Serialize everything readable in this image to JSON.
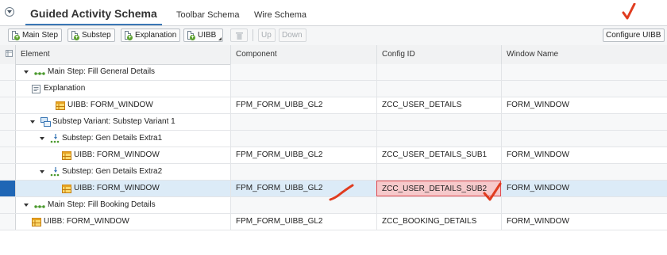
{
  "tabs": [
    {
      "label": "Guided Activity Schema",
      "active": true
    },
    {
      "label": "Toolbar Schema",
      "active": false
    },
    {
      "label": "Wire Schema",
      "active": false
    }
  ],
  "toolbar": {
    "main_step": "Main Step",
    "substep": "Substep",
    "explanation": "Explanation",
    "uibb": "UIBB",
    "up": "Up",
    "down": "Down",
    "configure_uibb": "Configure UIBB"
  },
  "columns": {
    "element": "Element",
    "component": "Component",
    "config_id": "Config ID",
    "window_name": "Window Name"
  },
  "rows": [
    {
      "element": "Main Step: Fill General Details",
      "component": "",
      "config_id": "",
      "window_name": "",
      "expand": true,
      "icon": "main-step-icon"
    },
    {
      "element": "Explanation",
      "component": "",
      "config_id": "",
      "window_name": "",
      "expand": false,
      "icon": "explanation-icon"
    },
    {
      "element": "UIBB: FORM_WINDOW",
      "component": "FPM_FORM_UIBB_GL2",
      "config_id": "ZCC_USER_DETAILS",
      "window_name": "FORM_WINDOW",
      "expand": false,
      "icon": "uibb-icon"
    },
    {
      "element": "Substep Variant: Substep Variant 1",
      "component": "",
      "config_id": "",
      "window_name": "",
      "expand": true,
      "icon": "substep-variant-icon"
    },
    {
      "element": "Substep: Gen Details Extra1",
      "component": "",
      "config_id": "",
      "window_name": "",
      "expand": true,
      "icon": "substep-icon"
    },
    {
      "element": "UIBB: FORM_WINDOW",
      "component": "FPM_FORM_UIBB_GL2",
      "config_id": "ZCC_USER_DETAILS_SUB1",
      "window_name": "FORM_WINDOW",
      "expand": false,
      "icon": "uibb-icon"
    },
    {
      "element": "Substep: Gen Details Extra2",
      "component": "",
      "config_id": "",
      "window_name": "",
      "expand": true,
      "icon": "substep-icon"
    },
    {
      "element": "UIBB: FORM_WINDOW",
      "component": "FPM_FORM_UIBB_GL2",
      "config_id": "ZCC_USER_DETAILS_SUB2",
      "window_name": "FORM_WINDOW",
      "expand": false,
      "icon": "uibb-icon",
      "selected": true
    },
    {
      "element": "Main Step: Fill Booking Details",
      "component": "",
      "config_id": "",
      "window_name": "",
      "expand": true,
      "icon": "main-step-icon"
    },
    {
      "element": "UIBB: FORM_WINDOW",
      "component": "FPM_FORM_UIBB_GL2",
      "config_id": "ZCC_BOOKING_DETAILS",
      "window_name": "FORM_WINDOW",
      "expand": false,
      "icon": "uibb-icon"
    }
  ],
  "colors": {
    "accent": "#3a77b5",
    "selected_row": "#dcebf7",
    "highlight_fill": "#f6c9cb",
    "highlight_border": "#e0494f",
    "annotation_mark": "#e03c1f"
  }
}
